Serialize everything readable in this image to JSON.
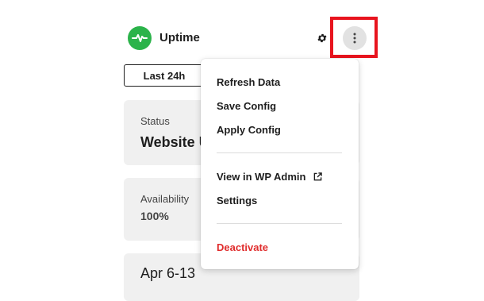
{
  "header": {
    "title": "Uptime",
    "logo_icon": "pulse-icon",
    "settings_icon": "gear-icon",
    "more_icon": "more-vertical-icon"
  },
  "tabs": [
    {
      "label": "Last 24h"
    }
  ],
  "cards": {
    "status": {
      "label": "Status",
      "value": "Website U"
    },
    "availability": {
      "label": "Availability",
      "value": "100%"
    },
    "range": {
      "value": "Apr 6-13"
    }
  },
  "menu": {
    "refresh": "Refresh Data",
    "save": "Save Config",
    "apply": "Apply Config",
    "view_wp": "View in WP Admin",
    "settings": "Settings",
    "deactivate": "Deactivate"
  },
  "colors": {
    "brand": "#2bb34a",
    "danger": "#e02d2d",
    "highlight": "#e8141e"
  }
}
